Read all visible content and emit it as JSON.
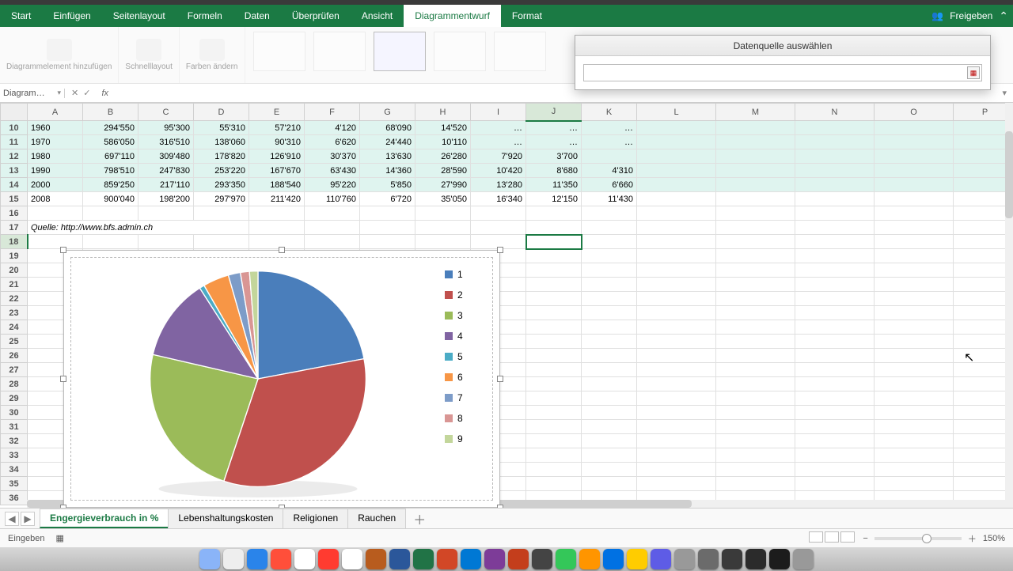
{
  "ribbon": {
    "tabs": [
      "Start",
      "Einfügen",
      "Seitenlayout",
      "Formeln",
      "Daten",
      "Überprüfen",
      "Ansicht",
      "Diagrammentwurf",
      "Format"
    ],
    "active_tab": "Diagrammentwurf",
    "share": "Freigeben",
    "groups": {
      "g1": "Diagrammelement hinzufügen",
      "g2": "Schnelllayout",
      "g3": "Farben ändern"
    }
  },
  "dialog": {
    "title": "Datenquelle auswählen",
    "value": ""
  },
  "namebox": "Diagram…",
  "columns": [
    "A",
    "B",
    "C",
    "D",
    "E",
    "F",
    "G",
    "H",
    "I",
    "J",
    "K",
    "L",
    "M",
    "N",
    "O",
    "P"
  ],
  "rows_start": 10,
  "data_rows": [
    {
      "r": 10,
      "hl": true,
      "cells": [
        "1960",
        "294'550",
        "95'300",
        "55'310",
        "57'210",
        "4'120",
        "68'090",
        "14'520",
        "…",
        "…",
        "…"
      ]
    },
    {
      "r": 11,
      "hl": true,
      "cells": [
        "1970",
        "586'050",
        "316'510",
        "138'060",
        "90'310",
        "6'620",
        "24'440",
        "10'110",
        "…",
        "…",
        "…"
      ]
    },
    {
      "r": 12,
      "hl": true,
      "cells": [
        "1980",
        "697'110",
        "309'480",
        "178'820",
        "126'910",
        "30'370",
        "13'630",
        "26'280",
        "7'920",
        "3'700",
        ""
      ]
    },
    {
      "r": 13,
      "hl": true,
      "cells": [
        "1990",
        "798'510",
        "247'830",
        "253'220",
        "167'670",
        "63'430",
        "14'360",
        "28'590",
        "10'420",
        "8'680",
        "4'310"
      ]
    },
    {
      "r": 14,
      "hl": true,
      "cells": [
        "2000",
        "859'250",
        "217'110",
        "293'350",
        "188'540",
        "95'220",
        "5'850",
        "27'990",
        "13'280",
        "11'350",
        "6'660"
      ]
    },
    {
      "r": 15,
      "hl": false,
      "cells": [
        "2008",
        "900'040",
        "198'200",
        "297'970",
        "211'420",
        "110'760",
        "6'720",
        "35'050",
        "16'340",
        "12'150",
        "11'430"
      ]
    }
  ],
  "source_row": {
    "r": 17,
    "text": "Quelle: http://www.bfs.admin.ch"
  },
  "active_cell": {
    "r": 18,
    "c": "J"
  },
  "blank_rows": [
    16,
    17,
    18,
    19,
    20,
    21,
    22,
    23,
    24,
    25,
    26,
    27,
    28,
    29,
    30,
    31,
    32,
    33,
    34,
    35,
    36
  ],
  "chart_data": {
    "type": "pie",
    "title": "",
    "series": [
      {
        "name": "2008",
        "values": [
          198200,
          297970,
          211420,
          110760,
          6720,
          35050,
          16340,
          12150,
          11430
        ]
      }
    ],
    "categories": [
      "1",
      "2",
      "3",
      "4",
      "5",
      "6",
      "7",
      "8",
      "9"
    ],
    "colors": [
      "#4a7ebb",
      "#c0504d",
      "#9bbb59",
      "#8064a2",
      "#4bacc6",
      "#f79646",
      "#7d9cc8",
      "#d99694",
      "#c3d69b"
    ],
    "legend_position": "right"
  },
  "sheet_tabs": {
    "tabs": [
      "Engergieverbrauch in %",
      "Lebenshaltungskosten",
      "Religionen",
      "Rauchen"
    ],
    "active": "Engergieverbrauch in %"
  },
  "status": {
    "mode": "Eingeben",
    "zoom": "150%"
  }
}
